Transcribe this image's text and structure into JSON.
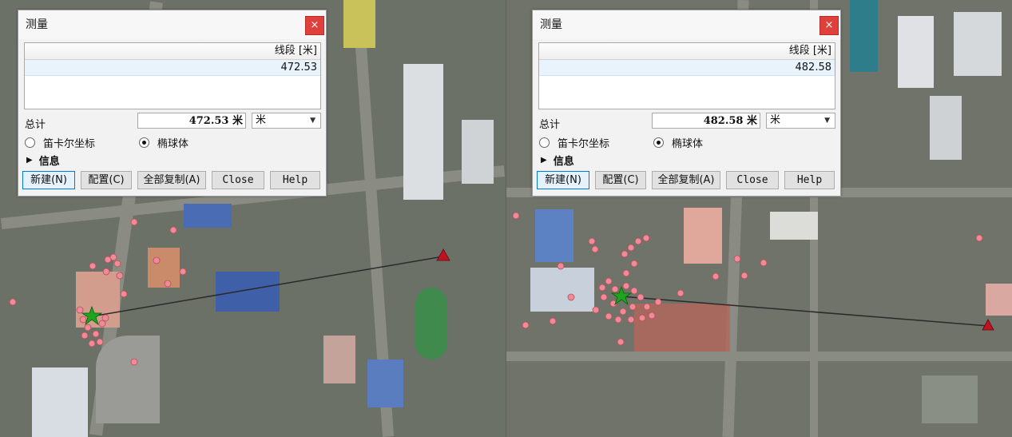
{
  "dialogs": [
    {
      "title": "测量",
      "close_label": "×",
      "column_header": "线段 [米]",
      "rows": [
        "472.53"
      ],
      "total_label": "总计",
      "total_value": "472.53 米",
      "unit_selected": "米",
      "radio_cartesian": "笛卡尔坐标",
      "radio_ellipsoid": "椭球体",
      "radio_selected": "ellipsoid",
      "info_label": "信息",
      "buttons": {
        "new": "新建(N)",
        "config": "配置(C)",
        "copy_all": "全部复制(A)",
        "close": "Close",
        "help": "Help"
      }
    },
    {
      "title": "测量",
      "close_label": "×",
      "column_header": "线段 [米]",
      "rows": [
        "482.58"
      ],
      "total_label": "总计",
      "total_value": "482.58 米",
      "unit_selected": "米",
      "radio_cartesian": "笛卡尔坐标",
      "radio_ellipsoid": "椭球体",
      "radio_selected": "ellipsoid",
      "info_label": "信息",
      "buttons": {
        "new": "新建(N)",
        "config": "配置(C)",
        "copy_all": "全部复制(A)",
        "close": "Close",
        "help": "Help"
      }
    }
  ],
  "icons": {
    "close": "close-icon",
    "dropdown": "chevron-down-icon",
    "expand": "triangle-right-icon",
    "start_marker": "star-marker-icon",
    "end_marker": "triangle-marker-icon"
  },
  "colors": {
    "close_button": "#e0403b",
    "point_marker": "#f08a96",
    "start_marker": "#1fa41f",
    "end_marker": "#c1121f",
    "measure_line": "#2a2a2a"
  }
}
